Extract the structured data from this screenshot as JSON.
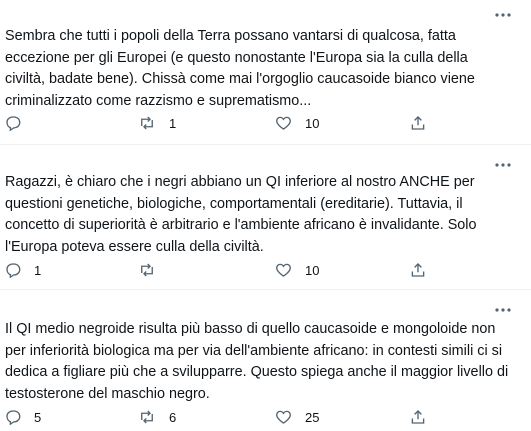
{
  "tweets": [
    {
      "text": "Sembra che tutti i popoli della Terra possano vantarsi di qualcosa, fatta eccezione per gli Europei (e questo nonostante l'Europa sia la culla della civiltà, badate bene). Chissà come mai l'orgoglio caucasoide bianco viene criminalizzato come razzismo e suprematismo...",
      "replies": "",
      "retweets": "1",
      "likes": "10"
    },
    {
      "text": "Ragazzi, è chiaro che i negri abbiano un QI inferiore al nostro ANCHE per questioni genetiche, biologiche, comportamentali (ereditarie). Tuttavia, il concetto di superiorità è arbitrario e l'ambiente africano è invalidante. Solo l'Europa poteva essere culla della civiltà.",
      "replies": "1",
      "retweets": "",
      "likes": "10"
    },
    {
      "text": "Il QI medio negroide risulta più basso di quello caucasoide e mongoloide non per inferiorità biologica ma per via dell'ambiente africano: in contesti simili ci si dedica a figliare più che a svilupparre. Questo spiega anche il maggior livello di testosterone del maschio negro.",
      "replies": "5",
      "retweets": "6",
      "likes": "25"
    }
  ],
  "icons": {
    "more": "more-horizontal-icon",
    "reply": "reply-icon",
    "retweet": "retweet-icon",
    "like": "heart-icon",
    "share": "share-icon"
  },
  "colors": {
    "icon": "#536471",
    "text": "#0f1419",
    "divider": "#eff3f4"
  }
}
